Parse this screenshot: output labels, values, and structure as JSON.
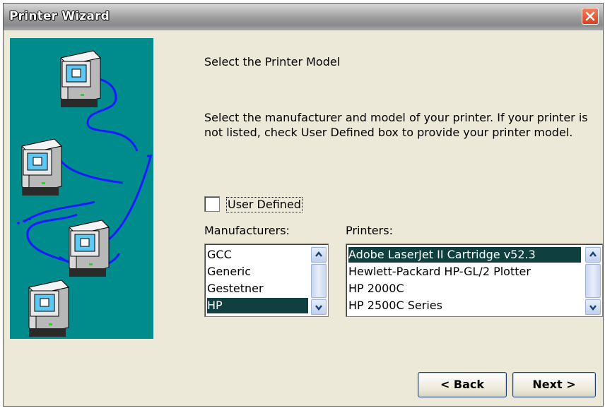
{
  "window": {
    "title": "Printer Wizard"
  },
  "page": {
    "heading": "Select the Printer Model",
    "description": "Select the manufacturer and model of your printer. If your printer is not listed, check User Defined box to provide your printer model."
  },
  "user_defined": {
    "label": "User Defined",
    "checked": false
  },
  "manufacturers": {
    "label": "Manufacturers:",
    "items": [
      "GCC",
      "Generic",
      "Gestetner",
      "HP"
    ],
    "selected": "HP"
  },
  "printers": {
    "label": "Printers:",
    "items": [
      "Adobe LaserJet II Cartridge v52.3",
      "Hewlett-Packard HP-GL/2 Plotter",
      "HP 2000C",
      "HP 2500C Series"
    ],
    "selected": "Adobe LaserJet II Cartridge v52.3"
  },
  "buttons": {
    "back": "< Back",
    "next": "Next >"
  },
  "colors": {
    "banner": "#008c8c",
    "selection": "#0f3f3f"
  }
}
